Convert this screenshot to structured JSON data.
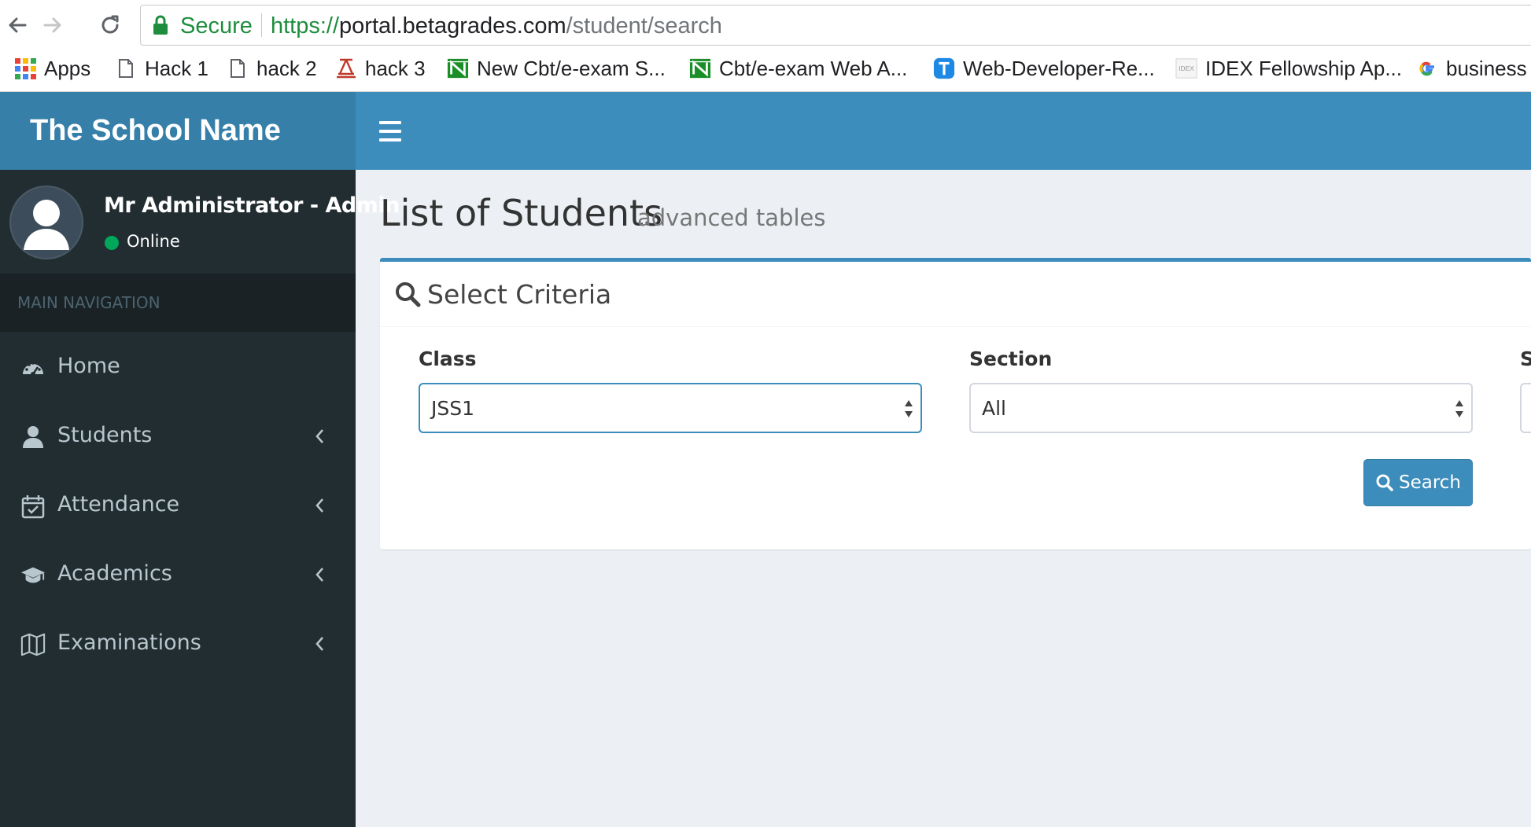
{
  "browser": {
    "secure_label": "Secure",
    "url_scheme": "https://",
    "url_host": "portal.betagrades.com",
    "url_path": "/student/search",
    "bookmarks": [
      {
        "label": "Apps",
        "icon": "apps-grid-icon"
      },
      {
        "label": "Hack 1",
        "icon": "page-icon"
      },
      {
        "label": "hack 2",
        "icon": "page-icon"
      },
      {
        "label": "hack 3",
        "icon": "stamp-icon"
      },
      {
        "label": "New Cbt/e-exam S...",
        "icon": "green-n-icon"
      },
      {
        "label": "Cbt/e-exam Web A...",
        "icon": "green-n-icon"
      },
      {
        "label": "Web-Developer-Re...",
        "icon": "blue-t-icon"
      },
      {
        "label": "IDEX Fellowship Ap...",
        "icon": "idex-icon"
      },
      {
        "label": "business",
        "icon": "google-g-icon"
      }
    ]
  },
  "header": {
    "school_name": "The School Name",
    "brand_color": "#3c8dbc"
  },
  "sidebar": {
    "user_name": "Mr Administrator - Admin",
    "status": "Online",
    "nav_header": "MAIN NAVIGATION",
    "items": [
      {
        "label": "Home",
        "icon": "dashboard-icon",
        "has_children": false
      },
      {
        "label": "Students",
        "icon": "user-icon",
        "has_children": true
      },
      {
        "label": "Attendance",
        "icon": "calendar-check-icon",
        "has_children": true
      },
      {
        "label": "Academics",
        "icon": "graduation-cap-icon",
        "has_children": true
      },
      {
        "label": "Examinations",
        "icon": "map-icon",
        "has_children": true
      }
    ]
  },
  "main": {
    "title": "List of Students",
    "subtitle": "advanced tables",
    "box_title": "Select Criteria",
    "class_label": "Class",
    "class_value": "JSS1",
    "section_label": "Section",
    "section_value": "All",
    "third_label": "S",
    "search_button": "Search"
  }
}
